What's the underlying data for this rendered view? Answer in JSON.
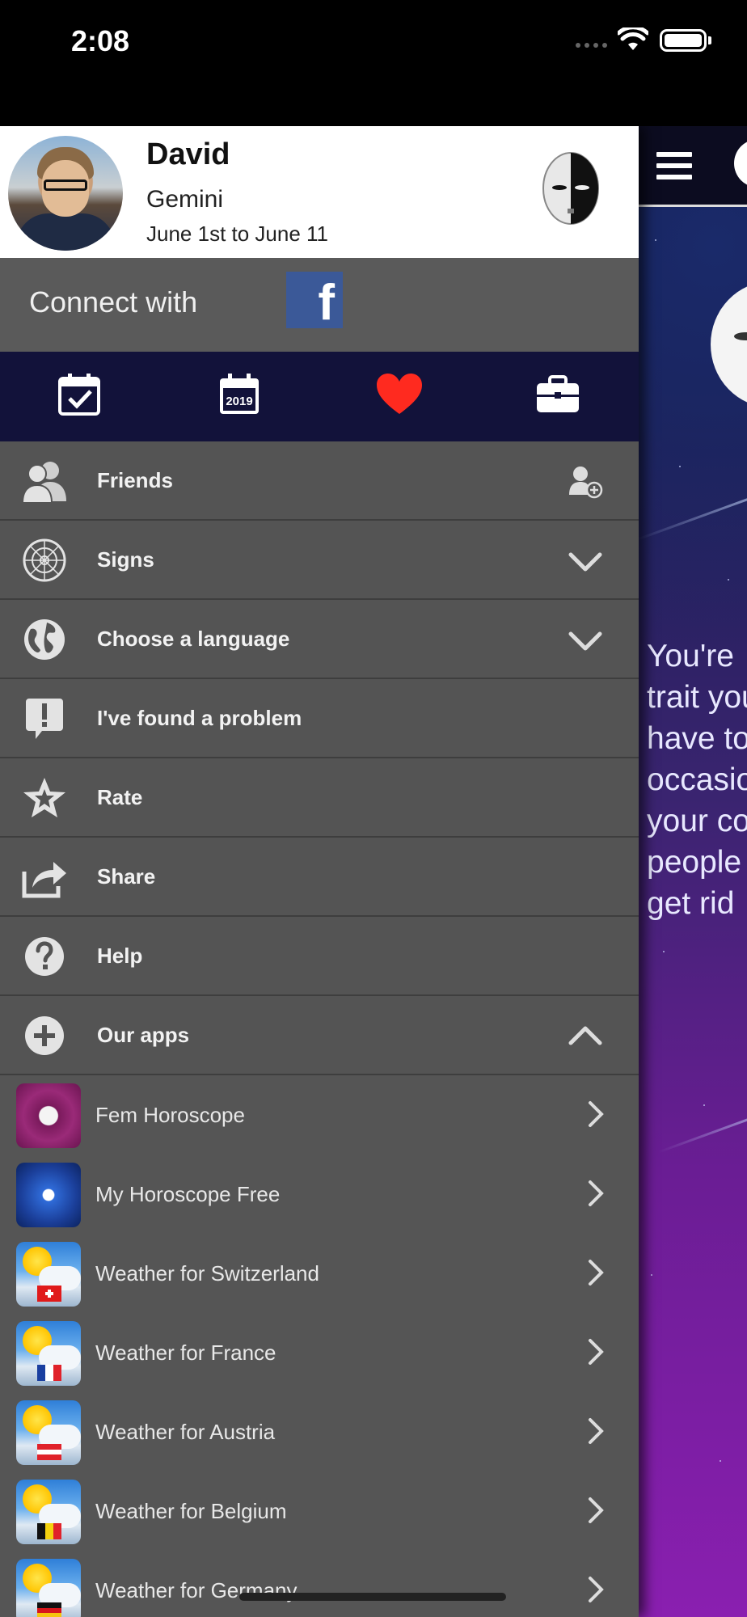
{
  "status_bar": {
    "time": "2:08"
  },
  "profile": {
    "name": "David",
    "sign": "Gemini",
    "dates": "June 1st to June 11"
  },
  "connect": {
    "label": "Connect with",
    "service_icon": "facebook-icon"
  },
  "icon_bar": {
    "items": [
      {
        "icon": "calendar-check-icon",
        "selected": false
      },
      {
        "icon": "calendar-2019-icon",
        "label": "2019",
        "selected": false
      },
      {
        "icon": "heart-icon",
        "selected": true,
        "color": "#ff2a1f"
      },
      {
        "icon": "briefcase-icon",
        "selected": false
      }
    ]
  },
  "menu": {
    "items": [
      {
        "label": "Friends",
        "icon": "friends-icon",
        "right": "add-friend-icon"
      },
      {
        "label": "Signs",
        "icon": "zodiac-wheel-icon",
        "right": "chevron-down-icon"
      },
      {
        "label": "Choose a language",
        "icon": "globe-icon",
        "right": "chevron-down-icon"
      },
      {
        "label": "I've found a problem",
        "icon": "exclamation-bubble-icon"
      },
      {
        "label": "Rate",
        "icon": "star-icon"
      },
      {
        "label": "Share",
        "icon": "share-icon"
      },
      {
        "label": "Help",
        "icon": "help-icon"
      },
      {
        "label": "Our apps",
        "icon": "plus-circle-icon",
        "right": "chevron-up-icon"
      }
    ]
  },
  "apps": {
    "items": [
      {
        "label": "Fem Horoscope",
        "icon": "fem-horoscope-app-icon"
      },
      {
        "label": "My Horoscope Free",
        "icon": "my-horoscope-app-icon"
      },
      {
        "label": "Weather for Switzerland",
        "icon": "weather-switzerland-app-icon"
      },
      {
        "label": "Weather for France",
        "icon": "weather-france-app-icon"
      },
      {
        "label": "Weather for Austria",
        "icon": "weather-austria-app-icon"
      },
      {
        "label": "Weather for Belgium",
        "icon": "weather-belgium-app-icon"
      },
      {
        "label": "Weather for Germany",
        "icon": "weather-germany-app-icon"
      }
    ]
  },
  "main_peek": {
    "text_lines": [
      "You're ",
      "trait you",
      "have to",
      "occasio",
      "your co",
      "people",
      "get rid"
    ]
  },
  "colors": {
    "drawer_bg": "#545454",
    "icon_bar_bg": "#12123a",
    "facebook": "#3b5998",
    "accent_heart": "#ff2a1f"
  }
}
